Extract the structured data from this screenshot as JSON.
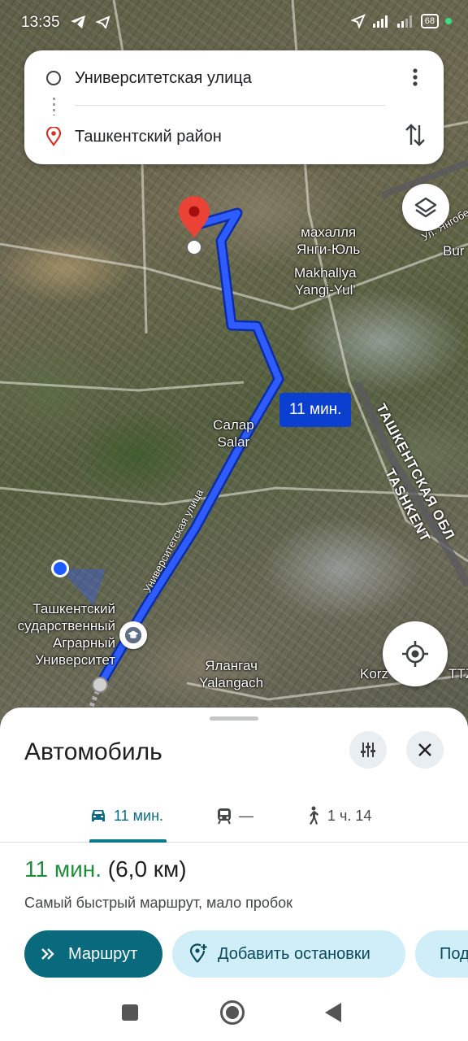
{
  "status_bar": {
    "time": "13:35",
    "battery": "68"
  },
  "route_card": {
    "origin": "Университетская улица",
    "destination": "Ташкентский район"
  },
  "map": {
    "labels": {
      "mahalla_ru": "махалля\nЯнги-Юль",
      "mahalla_en": "Makhallya\nYangi-Yul'",
      "salar": "Салар\nSalar",
      "university": "Ташкентский\nсударственный\nАграрный\nУниверситет",
      "yalangach": "Ялангач\nYalangach",
      "korz": "Korz",
      "ttz": "TTZ",
      "bur": "Bur",
      "yangi_edge": "Ул. Янгобе",
      "road": "Университетская улица",
      "region_ru": "ТАШКЕНТСКАЯ ОБЛ",
      "region_en": "TASHKENT"
    },
    "route_time_chip": "11 мин.",
    "route_color": "#1a4dff"
  },
  "sheet": {
    "title": "Автомобиль",
    "tabs": [
      {
        "label": "11 мин.",
        "icon": "car-icon",
        "active": true
      },
      {
        "label": "—",
        "icon": "train-icon",
        "active": false
      },
      {
        "label": "1 ч. 14",
        "icon": "walk-icon",
        "active": false
      }
    ],
    "summary_time": "11 мин.",
    "summary_distance": "(6,0 км)",
    "description": "Самый быстрый маршрут, мало пробок",
    "buttons": {
      "route": "Маршрут",
      "add_stops": "Добавить остановки",
      "share": "Поделиться"
    }
  }
}
